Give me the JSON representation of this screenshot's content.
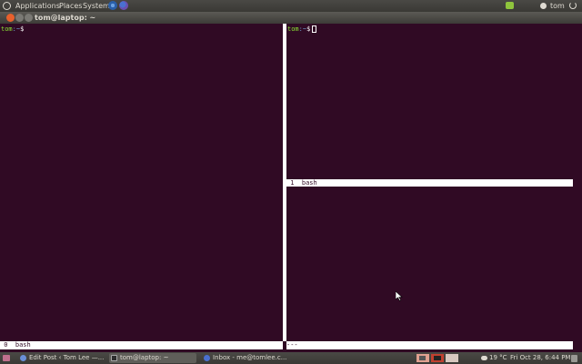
{
  "top_panel": {
    "menus": [
      "Applications",
      "Places",
      "System"
    ],
    "user": "tom"
  },
  "window": {
    "title": "tom@laptop: ~"
  },
  "terminal": {
    "pane0": {
      "prompt_user": "tom",
      "prompt_path": ":~",
      "prompt_symbol": "$",
      "status": " 0  bash"
    },
    "pane1": {
      "prompt_user": "tom",
      "prompt_path": ":~",
      "prompt_symbol": "$",
      "status": " 1  bash"
    },
    "pane2": {
      "status": "---"
    }
  },
  "taskbar": {
    "tasks": [
      {
        "label": "Edit Post ‹ Tom Lee —...",
        "icon": "browser-icon"
      },
      {
        "label": "tom@laptop: ~",
        "icon": "terminal-icon"
      },
      {
        "label": "Inbox - me@tomlee.c...",
        "icon": "mail-icon"
      }
    ],
    "weather": "19 °C",
    "clock": "Fri Oct 28,  6:44 PM"
  },
  "colors": {
    "terminal_bg": "#300a24",
    "prompt_user": "#8ae234",
    "prompt_path": "#729fcf",
    "close_button": "#e8602c"
  }
}
